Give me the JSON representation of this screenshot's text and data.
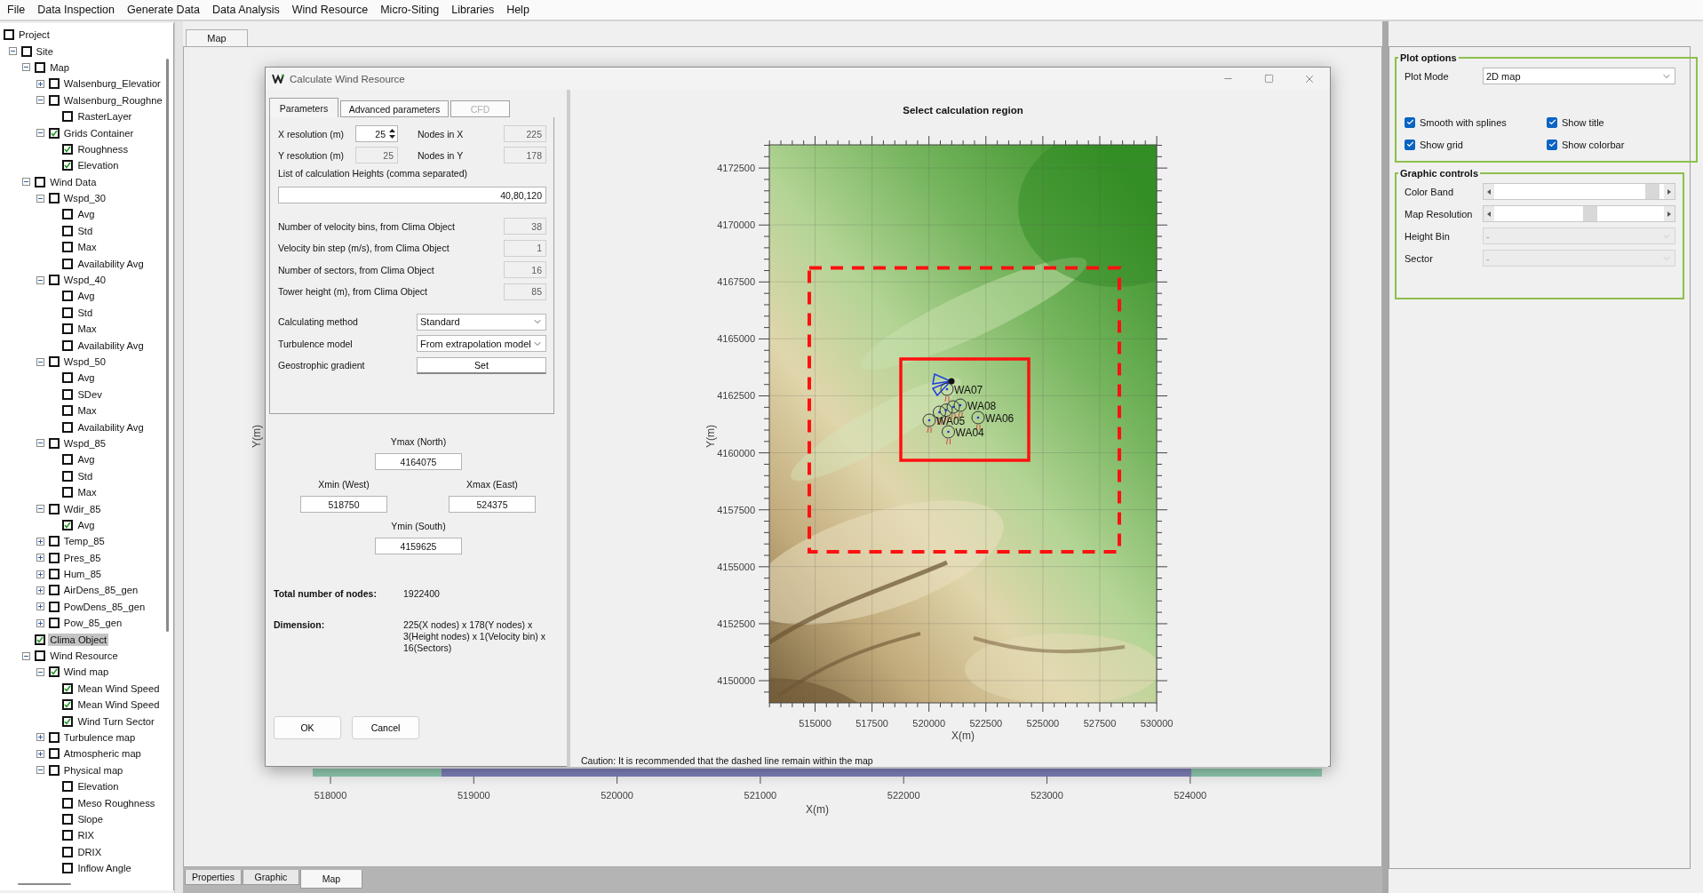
{
  "menu": [
    "File",
    "Data Inspection",
    "Generate Data",
    "Data Analysis",
    "Wind Resource",
    "Micro-Siting",
    "Libraries",
    "Help"
  ],
  "tree": [
    {
      "label": "Project",
      "checked": false,
      "selected": false,
      "children": [
        {
          "label": "Site",
          "checked": false,
          "selected": false,
          "expanded": true,
          "children": [
            {
              "label": "Map",
              "checked": false,
              "selected": false,
              "expanded": true,
              "children": [
                {
                  "label": "Walsenburg_Elevatior",
                  "checked": false,
                  "selected": false,
                  "expanded": false
                },
                {
                  "label": "Walsenburg_Roughne",
                  "checked": false,
                  "selected": false,
                  "expanded": true,
                  "children": [
                    {
                      "label": "RasterLayer",
                      "checked": false,
                      "selected": false
                    }
                  ]
                },
                {
                  "label": "Grids Container",
                  "checked": true,
                  "selected": false,
                  "expanded": true,
                  "children": [
                    {
                      "label": "Roughness",
                      "checked": true,
                      "selected": false
                    },
                    {
                      "label": "Elevation",
                      "checked": true,
                      "selected": false
                    }
                  ]
                }
              ]
            },
            {
              "label": "Wind Data",
              "checked": false,
              "selected": false,
              "expanded": true,
              "children": [
                {
                  "label": "Wspd_30",
                  "checked": false,
                  "selected": false,
                  "expanded": true,
                  "children": [
                    {
                      "label": "Avg",
                      "checked": false,
                      "selected": false
                    },
                    {
                      "label": "Std",
                      "checked": false,
                      "selected": false
                    },
                    {
                      "label": "Max",
                      "checked": false,
                      "selected": false
                    },
                    {
                      "label": "Availability Avg",
                      "checked": false,
                      "selected": false
                    }
                  ]
                },
                {
                  "label": "Wspd_40",
                  "checked": false,
                  "selected": false,
                  "expanded": true,
                  "children": [
                    {
                      "label": "Avg",
                      "checked": false,
                      "selected": false
                    },
                    {
                      "label": "Std",
                      "checked": false,
                      "selected": false
                    },
                    {
                      "label": "Max",
                      "checked": false,
                      "selected": false
                    },
                    {
                      "label": "Availability Avg",
                      "checked": false,
                      "selected": false
                    }
                  ]
                },
                {
                  "label": "Wspd_50",
                  "checked": false,
                  "selected": false,
                  "expanded": true,
                  "children": [
                    {
                      "label": "Avg",
                      "checked": false,
                      "selected": false
                    },
                    {
                      "label": "SDev",
                      "checked": false,
                      "selected": false
                    },
                    {
                      "label": "Max",
                      "checked": false,
                      "selected": false
                    },
                    {
                      "label": "Availability Avg",
                      "checked": false,
                      "selected": false
                    }
                  ]
                },
                {
                  "label": "Wspd_85",
                  "checked": false,
                  "selected": false,
                  "expanded": true,
                  "children": [
                    {
                      "label": "Avg",
                      "checked": false,
                      "selected": false
                    },
                    {
                      "label": "Std",
                      "checked": false,
                      "selected": false
                    },
                    {
                      "label": "Max",
                      "checked": false,
                      "selected": false
                    }
                  ]
                },
                {
                  "label": "Wdir_85",
                  "checked": false,
                  "selected": false,
                  "expanded": true,
                  "children": [
                    {
                      "label": "Avg",
                      "checked": true,
                      "selected": false
                    }
                  ]
                },
                {
                  "label": "Temp_85",
                  "checked": false,
                  "selected": false,
                  "expanded": false
                },
                {
                  "label": "Pres_85",
                  "checked": false,
                  "selected": false,
                  "expanded": false
                },
                {
                  "label": "Hum_85",
                  "checked": false,
                  "selected": false,
                  "expanded": false
                },
                {
                  "label": "AirDens_85_gen",
                  "checked": false,
                  "selected": false,
                  "expanded": false
                },
                {
                  "label": "PowDens_85_gen",
                  "checked": false,
                  "selected": false,
                  "expanded": false
                },
                {
                  "label": "Pow_85_gen",
                  "checked": false,
                  "selected": false,
                  "expanded": false
                }
              ]
            },
            {
              "label": "Clima Object",
              "checked": true,
              "selected": true
            },
            {
              "label": "Wind Resource",
              "checked": false,
              "selected": false,
              "expanded": true,
              "children": [
                {
                  "label": "Wind map",
                  "checked": true,
                  "selected": false,
                  "expanded": true,
                  "children": [
                    {
                      "label": "Mean Wind Speed",
                      "checked": true,
                      "selected": false
                    },
                    {
                      "label": "Mean Wind Speed",
                      "checked": true,
                      "selected": false
                    },
                    {
                      "label": "Wind Turn Sector",
                      "checked": true,
                      "selected": false
                    }
                  ]
                },
                {
                  "label": "Turbulence map",
                  "checked": false,
                  "selected": false,
                  "expanded": false
                },
                {
                  "label": "Atmospheric map",
                  "checked": false,
                  "selected": false,
                  "expanded": false
                },
                {
                  "label": "Physical map",
                  "checked": false,
                  "selected": false,
                  "expanded": true,
                  "children": [
                    {
                      "label": "Elevation",
                      "checked": false,
                      "selected": false
                    },
                    {
                      "label": "Meso Roughness",
                      "checked": false,
                      "selected": false
                    },
                    {
                      "label": "Slope",
                      "checked": false,
                      "selected": false
                    },
                    {
                      "label": "RIX",
                      "checked": false,
                      "selected": false
                    },
                    {
                      "label": "DRIX",
                      "checked": false,
                      "selected": false
                    },
                    {
                      "label": "Inflow Angle",
                      "checked": false,
                      "selected": false
                    }
                  ]
                }
              ]
            }
          ]
        }
      ]
    }
  ],
  "main_tabs": [
    {
      "label": "Map",
      "selected": true
    }
  ],
  "background_plot": {
    "xticks": [
      "518000",
      "519000",
      "520000",
      "521000",
      "522000",
      "523000",
      "524000"
    ],
    "xlabel": "X(m)",
    "ylabel": "Y(m)"
  },
  "bottom_tabs": [
    {
      "label": "Properties",
      "selected": false
    },
    {
      "label": "Graphic",
      "selected": false
    },
    {
      "label": "Map",
      "selected": true
    }
  ],
  "dialog": {
    "title": "Calculate Wind Resource",
    "tabs": [
      {
        "label": "Parameters",
        "selected": true,
        "disabled": false
      },
      {
        "label": "Advanced parameters",
        "selected": false,
        "disabled": false
      },
      {
        "label": "CFD",
        "selected": false,
        "disabled": true
      }
    ],
    "resolution_rows": [
      {
        "label": "X resolution (m)",
        "value": "25",
        "kind": "spin",
        "nodes_label": "Nodes in X",
        "nodes_value": "225"
      },
      {
        "label": "Y resolution (m)",
        "value": "25",
        "kind": "readonly",
        "nodes_label": "Nodes in Y",
        "nodes_value": "178"
      }
    ],
    "heights": {
      "label": "List of calculation Heights (comma separated)",
      "value": "40,80,120"
    },
    "clima_fields": [
      {
        "label": "Number of velocity bins, from Clima Object",
        "value": "38"
      },
      {
        "label": "Velocity bin step (m/s), from Clima Object",
        "value": "1"
      },
      {
        "label": "Number of sectors, from Clima Object",
        "value": "16"
      },
      {
        "label": "Tower height (m), from Clima Object",
        "value": "85"
      }
    ],
    "options": [
      {
        "label": "Calculating method",
        "kind": "combo",
        "value": "Standard"
      },
      {
        "label": "Turbulence model",
        "kind": "combo",
        "value": "From extrapolation model"
      },
      {
        "label": "Geostrophic gradient",
        "kind": "button",
        "value": "Set"
      }
    ],
    "bounds": {
      "ymax": {
        "label": "Ymax (North)",
        "value": "4164075"
      },
      "xmin": {
        "label": "Xmin (West)",
        "value": "518750"
      },
      "xmax": {
        "label": "Xmax (East)",
        "value": "524375"
      },
      "ymin": {
        "label": "Ymin (South)",
        "value": "4159625"
      }
    },
    "summary": [
      {
        "label": "Total number of nodes:",
        "value": "1922400"
      },
      {
        "label": "Dimension:",
        "value": "225(X nodes) x 178(Y nodes) x 3(Height nodes) x 1(Velocity bin) x 16(Sectors)"
      }
    ],
    "buttons": [
      "OK",
      "Cancel"
    ],
    "plot": {
      "title": "Select calculation region",
      "xlabel": "X(m)",
      "ylabel": "Y(m)",
      "xticks": [
        "515000",
        "517500",
        "520000",
        "522500",
        "525000",
        "527500",
        "530000"
      ],
      "yticks": [
        "4172500",
        "4170000",
        "4167500",
        "4165000",
        "4162500",
        "4160000",
        "4157500",
        "4155000",
        "4152500",
        "4150000"
      ],
      "markers": [
        {
          "label": "WA07"
        },
        {
          "label": "WA08"
        },
        {
          "label": "WA05"
        },
        {
          "label": "WA06"
        },
        {
          "label": "WA04"
        }
      ],
      "caution": "Caution: It is recommended that the dashed line remain within the map"
    }
  },
  "plot_options": {
    "title": "Plot options",
    "plot_mode": {
      "label": "Plot Mode",
      "value": "2D map"
    },
    "checkboxes": [
      {
        "label": "Smooth with splines",
        "checked": true
      },
      {
        "label": "Show title",
        "checked": true
      },
      {
        "label": "Show grid",
        "checked": true
      },
      {
        "label": "Show colorbar",
        "checked": true
      }
    ]
  },
  "graphic_controls": {
    "title": "Graphic controls",
    "sliders": [
      {
        "label": "Color Band",
        "level": 0.97
      },
      {
        "label": "Map Resolution",
        "level": 0.57
      }
    ],
    "combos": [
      {
        "label": "Height Bin",
        "value": "-",
        "disabled": true
      },
      {
        "label": "Sector",
        "value": "-",
        "disabled": true
      }
    ]
  }
}
